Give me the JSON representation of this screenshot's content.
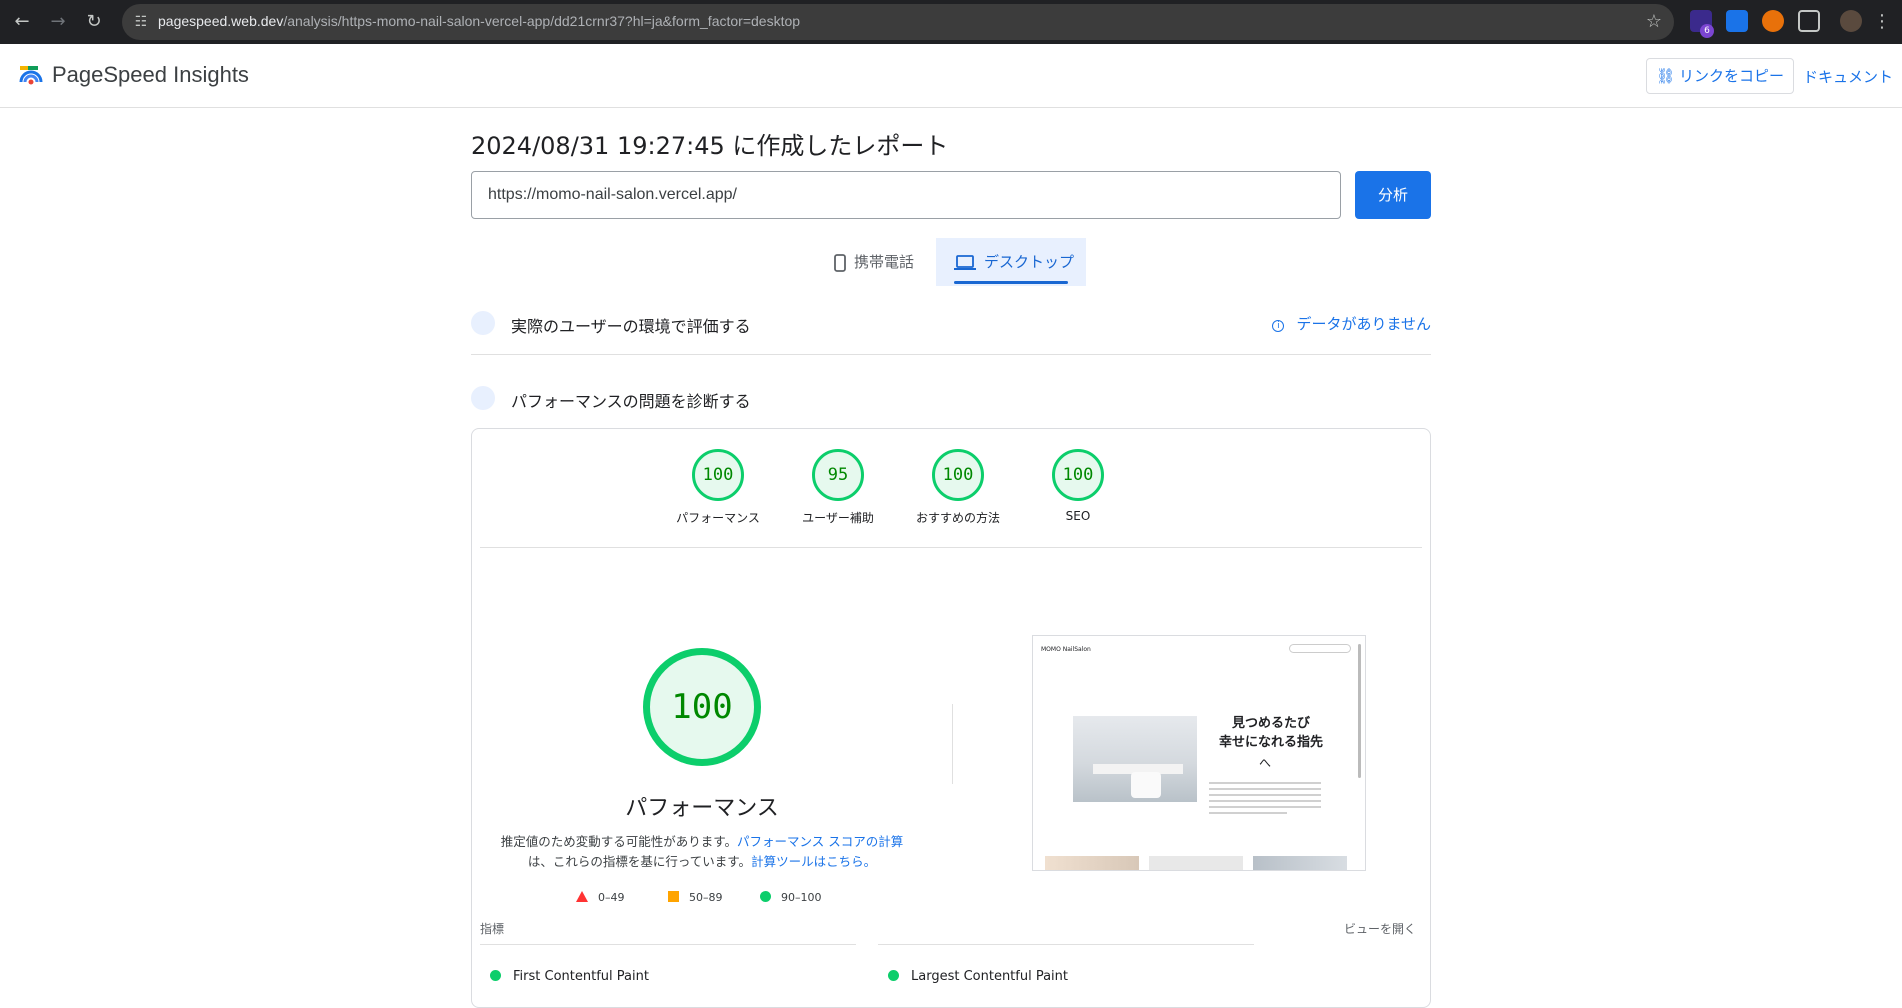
{
  "browser": {
    "url_host": "pagespeed.web.dev",
    "url_path": "/analysis/https-momo-nail-salon-vercel-app/dd21crnr37?hl=ja&form_factor=desktop",
    "extension_badge": "6"
  },
  "header": {
    "brand": "PageSpeed Insights",
    "copy_link": "リンクをコピー",
    "docs": "ドキュメント"
  },
  "report": {
    "title": "2024/08/31 19:27:45 に作成したレポート",
    "url_value": "https://momo-nail-salon.vercel.app/",
    "analyze": "分析"
  },
  "tabs": {
    "mobile": "携帯電話",
    "desktop": "デスクトップ"
  },
  "sections": {
    "field": "実際のユーザーの環境で評価する",
    "no_data": "データがありません",
    "diagnose": "パフォーマンスの問題を診断する"
  },
  "scores": [
    {
      "value": "100",
      "label": "パフォーマンス"
    },
    {
      "value": "95",
      "label": "ユーザー補助"
    },
    {
      "value": "100",
      "label": "おすすめの方法"
    },
    {
      "value": "100",
      "label": "SEO"
    }
  ],
  "performance": {
    "score": "100",
    "title": "パフォーマンス",
    "desc_a": "推定値のため変動する可能性があります。",
    "desc_link_a": "パフォーマンス スコアの計算",
    "desc_b": "は、これらの指標を基に行っています。",
    "desc_link_b": "計算ツールはこちら。"
  },
  "legend": {
    "bad": "0–49",
    "average": "50–89",
    "good": "90–100"
  },
  "preview": {
    "site_name": "MOMO NailSalon",
    "headline_1": "見つめるたび",
    "headline_2": "幸せになれる指先",
    "arrow": "へ"
  },
  "metrics": {
    "header": "指標",
    "expand": "ビューを開く",
    "fcp": "First Contentful Paint",
    "lcp": "Largest Contentful Paint"
  },
  "colors": {
    "accent": "#1a73e8",
    "good": "#0cce6b",
    "average": "#ffa400",
    "bad": "#ff3333"
  }
}
